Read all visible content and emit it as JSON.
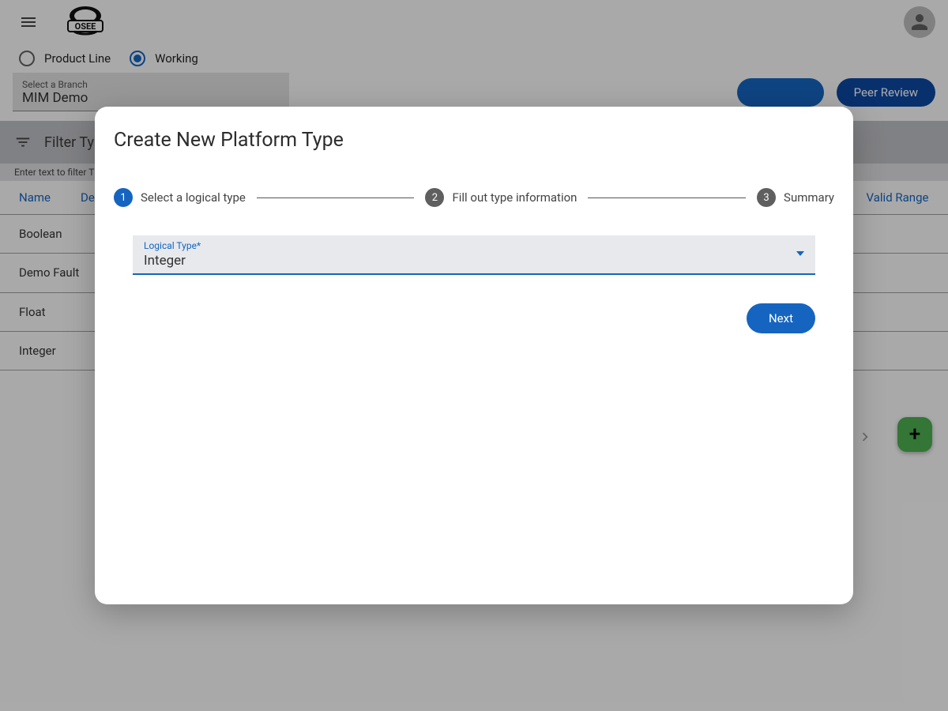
{
  "topbar": {
    "logo_text": "OSEE"
  },
  "mode": {
    "product_line_label": "Product Line",
    "working_label": "Working",
    "selected": "working"
  },
  "branch": {
    "label": "Select a Branch",
    "value": "MIM Demo"
  },
  "actions": {
    "peer_review_label": "Peer Review"
  },
  "filter": {
    "placeholder": "Filter Typ",
    "hint": "Enter text to filter T"
  },
  "table": {
    "headers": {
      "name": "Name",
      "description": "De",
      "valid_range": "Valid Range"
    },
    "rows": [
      {
        "name": "Boolean"
      },
      {
        "name": "Demo Fault"
      },
      {
        "name": "Float"
      },
      {
        "name": "Integer"
      }
    ]
  },
  "dialog": {
    "title": "Create New Platform Type",
    "steps": [
      {
        "num": "1",
        "label": "Select a logical type"
      },
      {
        "num": "2",
        "label": "Fill out type information"
      },
      {
        "num": "3",
        "label": "Summary"
      }
    ],
    "active_step": 0,
    "field": {
      "label": "Logical Type*",
      "value": "Integer"
    },
    "next_label": "Next"
  }
}
